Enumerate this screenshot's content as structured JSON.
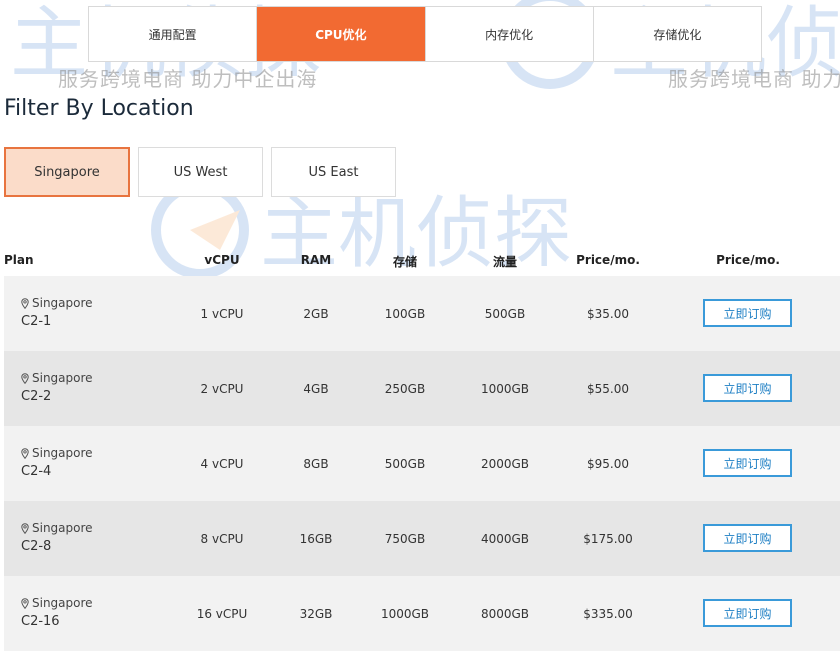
{
  "tabs": [
    {
      "label": "通用配置",
      "active": false
    },
    {
      "label": "CPU优化",
      "active": true
    },
    {
      "label": "内存优化",
      "active": false
    },
    {
      "label": "存储优化",
      "active": false
    }
  ],
  "filter_title": "Filter By Location",
  "locations": [
    {
      "label": "Singapore",
      "active": true
    },
    {
      "label": "US West",
      "active": false
    },
    {
      "label": "US East",
      "active": false
    }
  ],
  "table": {
    "headers": [
      "Plan",
      "vCPU",
      "RAM",
      "存储",
      "流量",
      "Price/mo.",
      "Price/mo."
    ],
    "rows": [
      {
        "location": "Singapore",
        "plan": "C2-1",
        "vcpu": "1 vCPU",
        "ram": "2GB",
        "storage": "100GB",
        "traffic": "500GB",
        "price": "$35.00",
        "button": "立即订购"
      },
      {
        "location": "Singapore",
        "plan": "C2-2",
        "vcpu": "2 vCPU",
        "ram": "4GB",
        "storage": "250GB",
        "traffic": "1000GB",
        "price": "$55.00",
        "button": "立即订购"
      },
      {
        "location": "Singapore",
        "plan": "C2-4",
        "vcpu": "4 vCPU",
        "ram": "8GB",
        "storage": "500GB",
        "traffic": "2000GB",
        "price": "$95.00",
        "button": "立即订购"
      },
      {
        "location": "Singapore",
        "plan": "C2-8",
        "vcpu": "8 vCPU",
        "ram": "16GB",
        "storage": "750GB",
        "traffic": "4000GB",
        "price": "$175.00",
        "button": "立即订购"
      },
      {
        "location": "Singapore",
        "plan": "C2-16",
        "vcpu": "16 vCPU",
        "ram": "32GB",
        "storage": "1000GB",
        "traffic": "8000GB",
        "price": "$335.00",
        "button": "立即订购"
      }
    ]
  },
  "watermark": {
    "logo_text": "主机侦探",
    "slogan": "服务跨境电商 助力中企出海"
  },
  "colors": {
    "accent": "#f26a32",
    "active_location_bg": "#fbdcc9",
    "button_border": "#3a9ad9"
  }
}
